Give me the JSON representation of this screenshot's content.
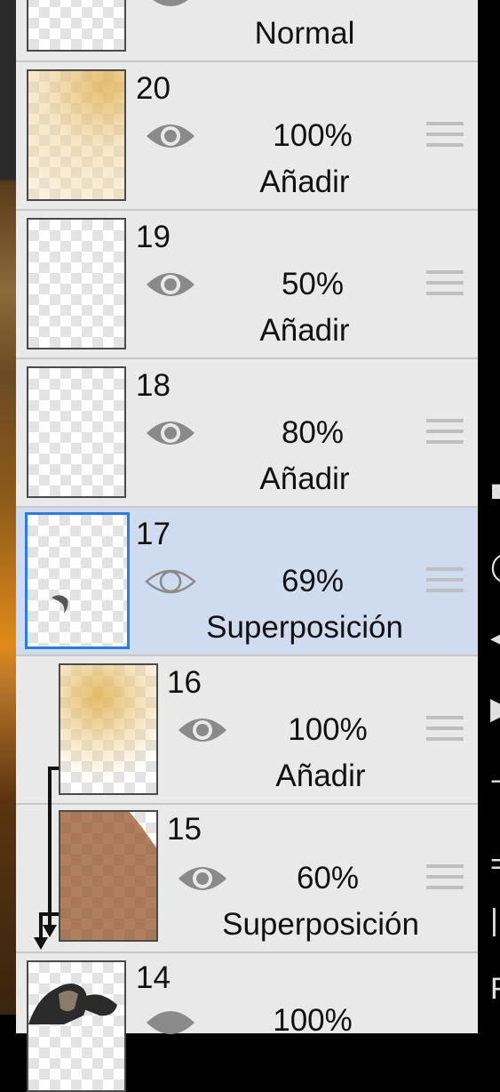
{
  "top_layer": {
    "mode": "Normal"
  },
  "layers": [
    {
      "number": "20",
      "opacity": "100%",
      "mode": "Añadir"
    },
    {
      "number": "19",
      "opacity": "50%",
      "mode": "Añadir"
    },
    {
      "number": "18",
      "opacity": "80%",
      "mode": "Añadir"
    },
    {
      "number": "17",
      "opacity": "69%",
      "mode": "Superposición",
      "selected": true
    },
    {
      "number": "16",
      "opacity": "100%",
      "mode": "Añadir",
      "clipped": true
    },
    {
      "number": "15",
      "opacity": "60%",
      "mode": "Superposición",
      "clipped": true
    },
    {
      "number": "14",
      "opacity": "100%"
    }
  ],
  "icons": {
    "visibility": "eye-icon",
    "reorder": "drag-handle-icon",
    "clipping": "clipping-arrow-icon"
  },
  "colors": {
    "selected_row": "#cfdbee",
    "selected_border": "#2b7de0",
    "panel": "#e9e9e9"
  }
}
